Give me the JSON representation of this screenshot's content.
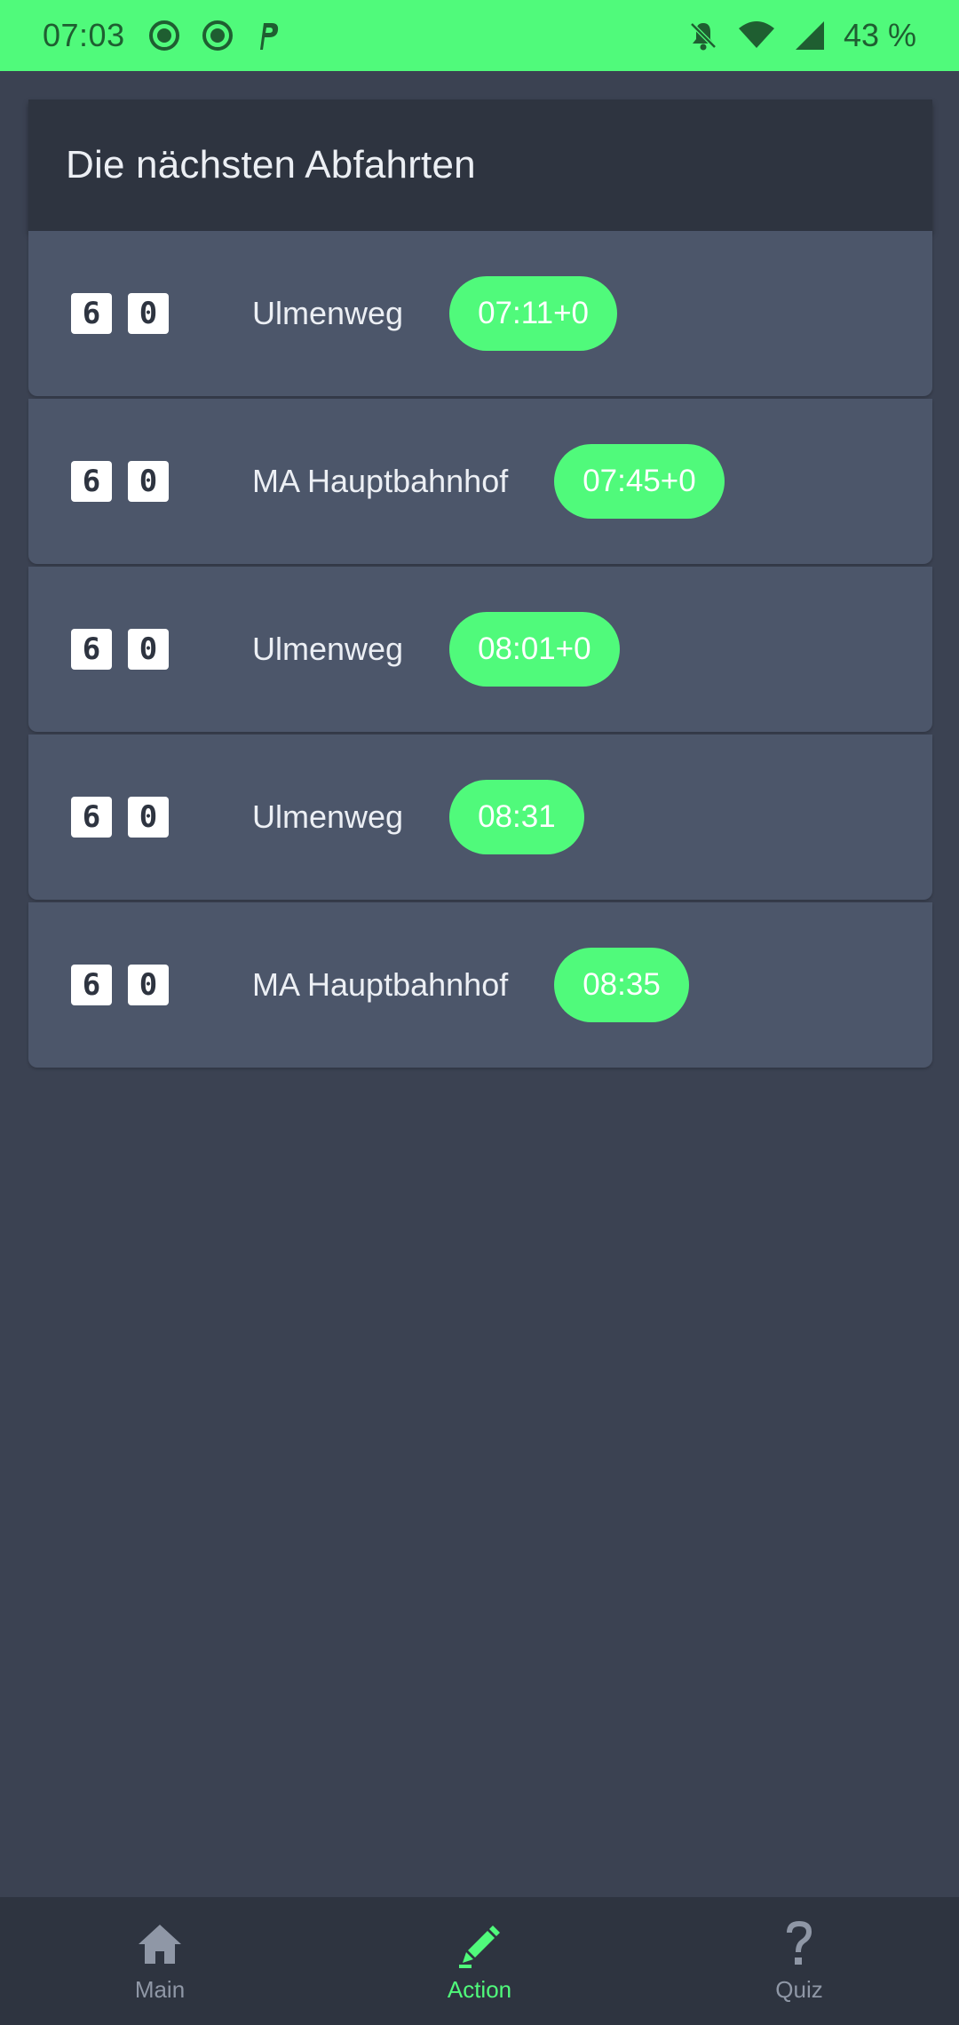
{
  "status_bar": {
    "time": "07:03",
    "battery": "43 %",
    "left_icons": [
      "record-icon",
      "record-icon",
      "parking-icon"
    ],
    "right_icons": [
      "bell-off-icon",
      "wifi-icon",
      "signal-icon"
    ]
  },
  "header": {
    "title": "Die nächsten Abfahrten"
  },
  "departures": [
    {
      "line_digits": [
        "6",
        "0"
      ],
      "destination": "Ulmenweg",
      "time": "07:11+0"
    },
    {
      "line_digits": [
        "6",
        "0"
      ],
      "destination": "MA Hauptbahnhof",
      "time": "07:45+0"
    },
    {
      "line_digits": [
        "6",
        "0"
      ],
      "destination": "Ulmenweg",
      "time": "08:01+0"
    },
    {
      "line_digits": [
        "6",
        "0"
      ],
      "destination": "Ulmenweg",
      "time": "08:31"
    },
    {
      "line_digits": [
        "6",
        "0"
      ],
      "destination": "MA Hauptbahnhof",
      "time": "08:35"
    }
  ],
  "bottom_nav": {
    "items": [
      {
        "label": "Main",
        "icon": "home-icon",
        "active": false
      },
      {
        "label": "Action",
        "icon": "edit-icon",
        "active": true
      },
      {
        "label": "Quiz",
        "icon": "question-icon",
        "active": false
      }
    ]
  },
  "colors": {
    "accent": "#50fa7b",
    "background": "#3b4252",
    "card": "#4c566a",
    "header": "#2e3440"
  }
}
